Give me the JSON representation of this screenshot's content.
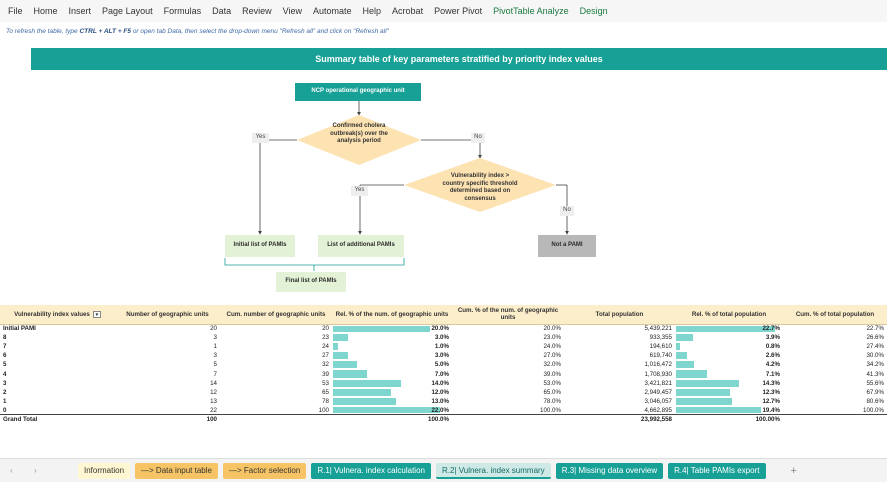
{
  "ribbon": [
    "File",
    "Home",
    "Insert",
    "Page Layout",
    "Formulas",
    "Data",
    "Review",
    "View",
    "Automate",
    "Help",
    "Acrobat",
    "Power Pivot",
    "PivotTable Analyze",
    "Design"
  ],
  "hint": {
    "pre": "To refresh the table, type ",
    "keys": "CTRL + ALT + F5",
    "post": " or open tab Data, then select the drop-down menu \"Refresh all\" and click on \"Refresh all\""
  },
  "banner": "Summary table of key parameters stratified by priority index values",
  "flow": {
    "start": "NCP operational geographic unit",
    "decision1": "Confirmed cholera outbreak(s) over the analysis period",
    "yes": "Yes",
    "no": "No",
    "decision2": "Vulnerability index > country specific threshold determined based on consensus",
    "initial": "Initial list of PAMIs",
    "additional": "List of additional PAMIs",
    "final": "Final list of PAMIs",
    "not": "Not a PAMI"
  },
  "table": {
    "headers": [
      "Vulnerability index values",
      "Number of geographic units",
      "Cum. number of geographic units",
      "Rel. % of the num. of geographic units",
      "Cum. % of the num. of geographic units",
      "Total population",
      "Rel. % of total population",
      "Cum. % of total population"
    ],
    "rows": [
      {
        "label": "Initial PAMI",
        "n": "20",
        "cn": "20",
        "rel": "20.0%",
        "relv": 20.0,
        "cum": "20.0%",
        "pop": "5,439,221",
        "relp": "22.7%",
        "relpv": 22.7,
        "cump": "22.7%"
      },
      {
        "label": "8",
        "n": "3",
        "cn": "23",
        "rel": "3.0%",
        "relv": 3.0,
        "cum": "23.0%",
        "pop": "933,355",
        "relp": "3.9%",
        "relpv": 3.9,
        "cump": "26.6%"
      },
      {
        "label": "7",
        "n": "1",
        "cn": "24",
        "rel": "1.0%",
        "relv": 1.0,
        "cum": "24.0%",
        "pop": "194,610",
        "relp": "0.8%",
        "relpv": 0.8,
        "cump": "27.4%"
      },
      {
        "label": "6",
        "n": "3",
        "cn": "27",
        "rel": "3.0%",
        "relv": 3.0,
        "cum": "27.0%",
        "pop": "619,740",
        "relp": "2.6%",
        "relpv": 2.6,
        "cump": "30.0%"
      },
      {
        "label": "5",
        "n": "5",
        "cn": "32",
        "rel": "5.0%",
        "relv": 5.0,
        "cum": "32.0%",
        "pop": "1,016,472",
        "relp": "4.2%",
        "relpv": 4.2,
        "cump": "34.2%"
      },
      {
        "label": "4",
        "n": "7",
        "cn": "39",
        "rel": "7.0%",
        "relv": 7.0,
        "cum": "39.0%",
        "pop": "1,708,930",
        "relp": "7.1%",
        "relpv": 7.1,
        "cump": "41.3%"
      },
      {
        "label": "3",
        "n": "14",
        "cn": "53",
        "rel": "14.0%",
        "relv": 14.0,
        "cum": "53.0%",
        "pop": "3,421,821",
        "relp": "14.3%",
        "relpv": 14.3,
        "cump": "55.6%"
      },
      {
        "label": "2",
        "n": "12",
        "cn": "65",
        "rel": "12.0%",
        "relv": 12.0,
        "cum": "65.0%",
        "pop": "2,949,457",
        "relp": "12.3%",
        "relpv": 12.3,
        "cump": "67.9%"
      },
      {
        "label": "1",
        "n": "13",
        "cn": "78",
        "rel": "13.0%",
        "relv": 13.0,
        "cum": "78.0%",
        "pop": "3,046,057",
        "relp": "12.7%",
        "relpv": 12.7,
        "cump": "80.6%"
      },
      {
        "label": "0",
        "n": "22",
        "cn": "100",
        "rel": "22.0%",
        "relv": 22.0,
        "cum": "100.0%",
        "pop": "4,662,895",
        "relp": "19.4%",
        "relpv": 19.4,
        "cump": "100.0%"
      }
    ],
    "total": {
      "label": "Grand Total",
      "n": "100",
      "rel": "100.0%",
      "pop": "23,992,558",
      "relp": "100.00%"
    }
  },
  "tabs": [
    {
      "label": "Information",
      "style": "info"
    },
    {
      "label": "—> Data input table",
      "style": "orange"
    },
    {
      "label": "—> Factor selection",
      "style": "orange"
    },
    {
      "label": "R.1| Vulnera. index calculation",
      "style": "teal"
    },
    {
      "label": "R.2| Vulnera. index summary",
      "style": "active"
    },
    {
      "label": "R.3| Missing data overview",
      "style": "teal"
    },
    {
      "label": "R.4| Table PAMIs export",
      "style": "teal"
    }
  ],
  "colors": {
    "accent": "#17a096",
    "header": "#fdeecb",
    "bar": "#7ed6cf",
    "decision": "#fde2b2"
  }
}
